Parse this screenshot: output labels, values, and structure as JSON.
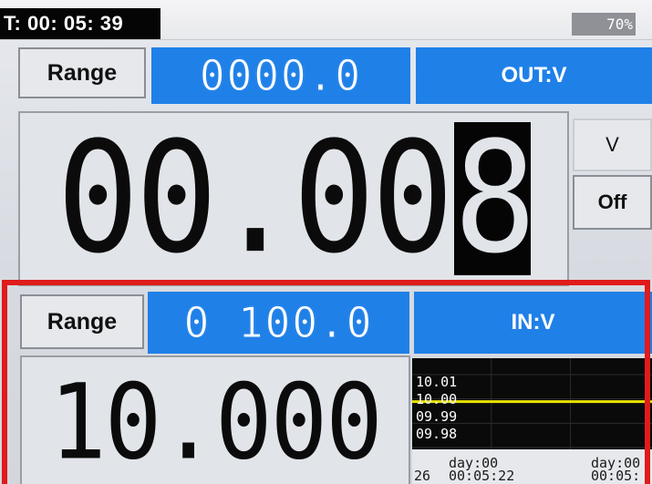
{
  "status": {
    "timer": "T: 00: 05: 39",
    "battery": "70%"
  },
  "output": {
    "range_label": "Range",
    "range_value": "0000.0",
    "mode_label": "OUT:V",
    "reading": "00.00",
    "reading_cursor_digit": "8",
    "unit": "V",
    "state_button": "Off"
  },
  "input": {
    "range_label": "Range",
    "range_value": "0 100.0",
    "mode_label": "IN:V",
    "reading": "10.000"
  },
  "chart_data": {
    "type": "line",
    "y_tick_labels": [
      "10.01",
      "10.00",
      "09.99",
      "09.98"
    ],
    "ylim": [
      9.98,
      10.01
    ],
    "series": [
      {
        "color": "#e8e200",
        "x": [
          0,
          1
        ],
        "values": [
          10.0,
          10.0
        ]
      }
    ],
    "x_tick_labels": [
      {
        "top": "day:00",
        "bottom": "00:05:22",
        "prefix": "26"
      },
      {
        "top": "day:00",
        "bottom": "00:05:"
      }
    ],
    "grid": true
  },
  "colors": {
    "accent_blue": "#1f80e8",
    "highlight_red": "#e01b1b",
    "trace_yellow": "#e8e200"
  }
}
